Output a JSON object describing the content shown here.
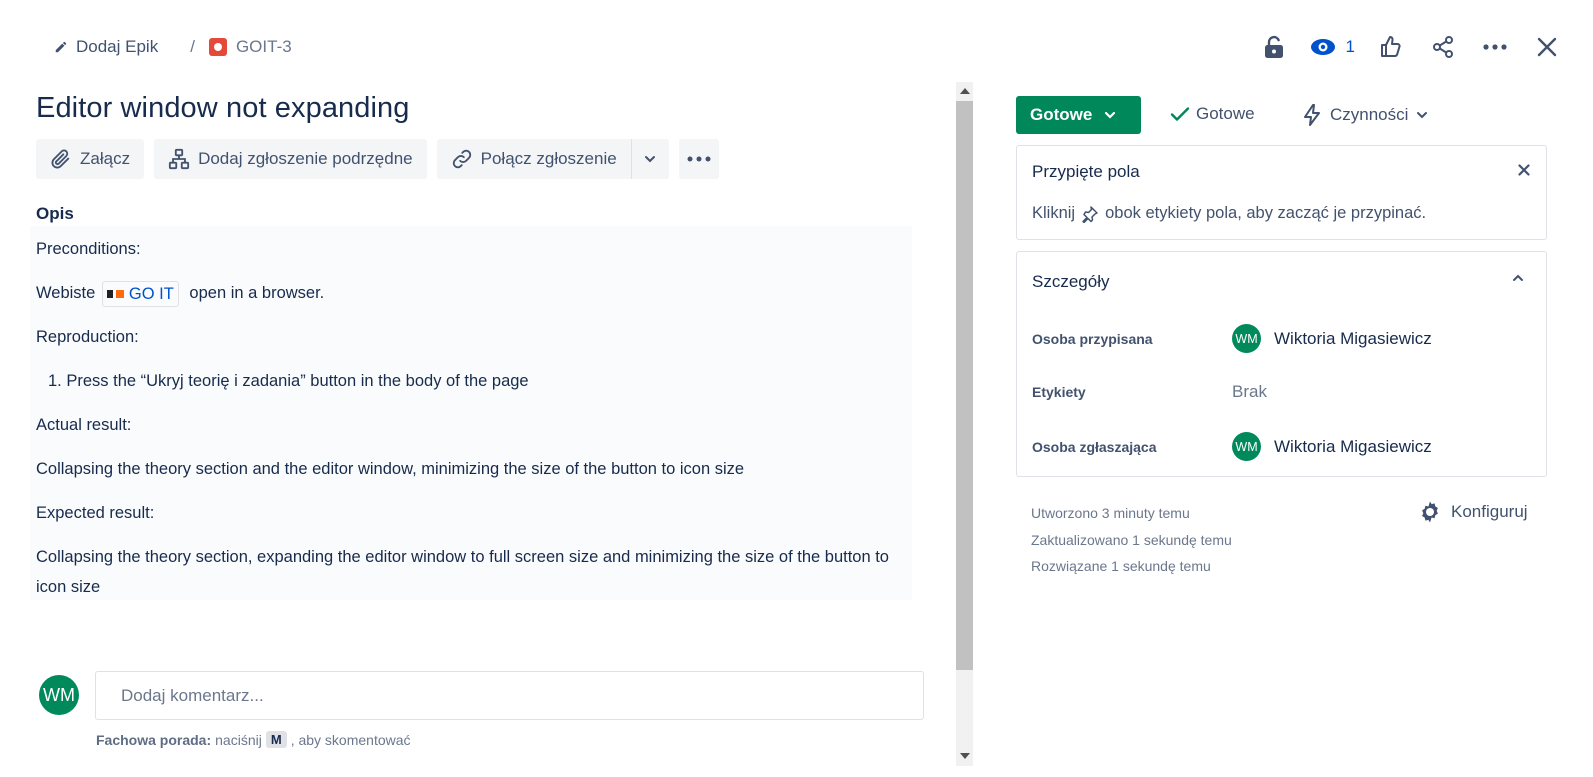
{
  "breadcrumb": {
    "epic_label": "Dodaj Epik",
    "separator": "/",
    "issue_key": "GOIT-3"
  },
  "header": {
    "watchers_count": "1"
  },
  "issue": {
    "title": "Editor window not expanding"
  },
  "toolbar": {
    "attach_label": "Załącz",
    "add_child_label": "Dodaj zgłoszenie podrzędne",
    "link_issue_label": "Połącz zgłoszenie"
  },
  "description": {
    "label": "Opis",
    "preconditions_heading": "Preconditions:",
    "website_prefix": "Webiste",
    "website_link": "GO IT",
    "website_suffix": "open in a browser.",
    "reproduction_heading": "Reproduction:",
    "step_1": "1. Press the “Ukryj teorię i zadania” button in the body of the page",
    "actual_heading": "Actual result:",
    "actual_text": "Collapsing the theory section and the editor window, minimizing the size of the button to icon size",
    "expected_heading": "Expected result:",
    "expected_text": "Collapsing the theory section, expanding the editor window to full screen size and minimizing the size of the button to icon size"
  },
  "comment": {
    "avatar_initials": "WM",
    "placeholder": "Dodaj komentarz...",
    "tip_bold": "Fachowa porada:",
    "tip_pre": "naciśnij",
    "tip_key": "M",
    "tip_post": ", aby skomentować"
  },
  "status": {
    "status_label": "Gotowe",
    "resolution_label": "Gotowe",
    "actions_label": "Czynności"
  },
  "pinned": {
    "title": "Przypięte pola",
    "hint_pre": "Kliknij",
    "hint_post": "obok etykiety pola, aby zacząć je przypinać."
  },
  "details": {
    "title": "Szczegóły",
    "fields": [
      {
        "label": "Osoba przypisana",
        "initials": "WM",
        "value": "Wiktoria Migasiewicz"
      },
      {
        "label": "Etykiety",
        "value": "Brak"
      },
      {
        "label": "Osoba zgłaszająca",
        "initials": "WM",
        "value": "Wiktoria Migasiewicz"
      }
    ]
  },
  "meta": {
    "created": "Utworzono 3 minuty temu",
    "updated": "Zaktualizowano 1 sekundę temu",
    "resolved": "Rozwiązane 1 sekundę temu",
    "configure_label": "Konfiguruj"
  },
  "colors": {
    "accent": "#0052cc",
    "status_done": "#00875a",
    "bug": "#e5493a",
    "avatar": "#008a5b"
  }
}
